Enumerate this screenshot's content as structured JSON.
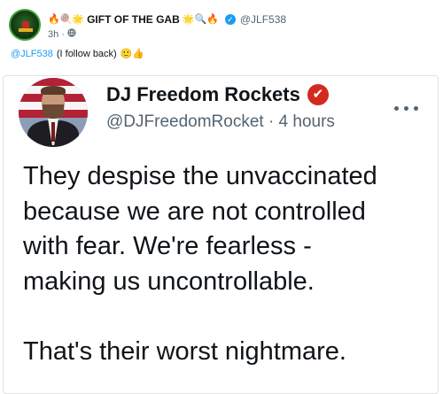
{
  "top_post": {
    "display_name": "GIFT OF THE GAB",
    "name_prefix_emoji": "🔥🍭🌟",
    "name_suffix_emoji": "🌟🔍🔥",
    "handle": "@JLF538",
    "time": "3h",
    "separator": "·",
    "reply_mention": "@JLF538",
    "reply_text": "(I follow back)",
    "reply_emoji": "🙂👍"
  },
  "quoted_tweet": {
    "display_name": "DJ Freedom Rockets",
    "verified_glyph": "✔",
    "handle_time": "@DJFreedomRocket · 4 hours",
    "text": "They despise the unvaccinated\nbecause we are not controlled\nwith fear. We're fearless -\nmaking us uncontrollable.\n\nThat's their worst nightmare."
  },
  "colors": {
    "link_blue": "#1d9bf0",
    "verified_red": "#d22a1f",
    "secondary_text": "#536471"
  }
}
